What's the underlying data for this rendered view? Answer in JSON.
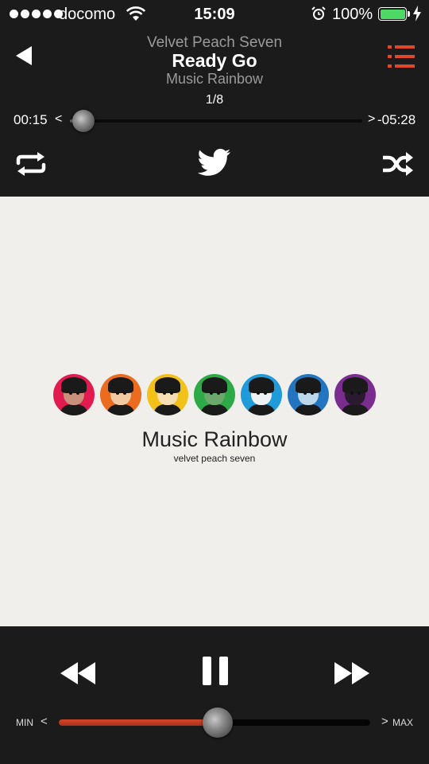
{
  "status_bar": {
    "carrier": "docomo",
    "time": "15:09",
    "battery_percent": "100%",
    "signal_bars": 5,
    "icons": [
      "wifi-icon",
      "alarm-icon",
      "battery-icon",
      "charging-bolt-icon"
    ]
  },
  "header": {
    "artist": "Velvet Peach Seven",
    "title": "Ready Go",
    "album": "Music Rainbow",
    "track_counter": "1/8",
    "back_icon": "back-triangle-icon",
    "playlist_icon": "list-icon"
  },
  "progress": {
    "elapsed": "00:15",
    "remaining": "-05:28",
    "left_arrow": "<",
    "right_arrow": ">",
    "fraction": 0.045
  },
  "controls": {
    "repeat_icon": "repeat-icon",
    "share_icon": "twitter-icon",
    "shuffle_icon": "shuffle-icon",
    "rewind_icon": "rewind-icon",
    "pause_icon": "pause-icon",
    "forward_icon": "fast-forward-icon"
  },
  "album_art": {
    "title": "Music Rainbow",
    "subtitle": "velvet peach seven",
    "face_colors": [
      "#e11b4f",
      "#ec6c1f",
      "#f2c21b",
      "#2da947",
      "#1f9bd9",
      "#2375c0",
      "#7a2c8f"
    ]
  },
  "volume": {
    "min_label": "MIN",
    "max_label": "MAX",
    "left_arrow": "<",
    "right_arrow": ">",
    "level": 0.51
  },
  "colors": {
    "accent": "#e0482a",
    "background": "#1b1b1b",
    "art_background": "#f0efeb"
  }
}
